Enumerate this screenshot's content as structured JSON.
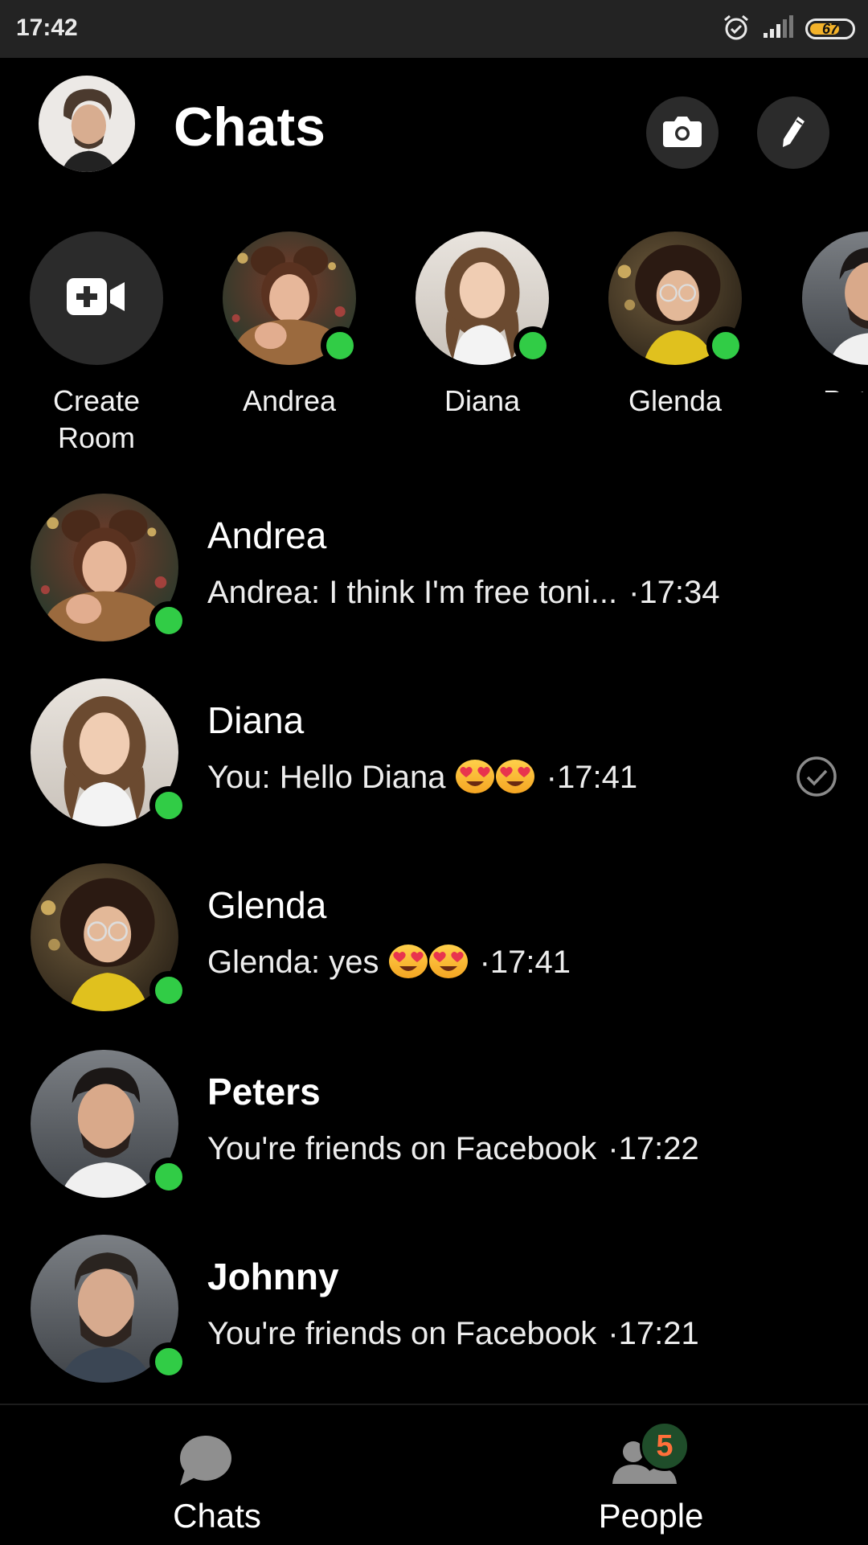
{
  "status_bar": {
    "time": "17:42",
    "battery": "67"
  },
  "header": {
    "title": "Chats"
  },
  "stories": [
    {
      "label": "Create Room"
    },
    {
      "label": "Andrea"
    },
    {
      "label": "Diana"
    },
    {
      "label": "Glenda"
    },
    {
      "label": "Pet"
    }
  ],
  "chats": [
    {
      "name": "Andrea",
      "preview": "Andrea: I think I'm free toni...",
      "time": "·17:34"
    },
    {
      "name": "Diana",
      "preview": "You: Hello Diana",
      "time": "·17:41"
    },
    {
      "name": "Glenda",
      "preview": "Glenda: yes",
      "time": "·17:41"
    },
    {
      "name": "Peters",
      "preview": "You're friends on Facebook",
      "time": "·17:22"
    },
    {
      "name": "Johnny",
      "preview": "You're friends on Facebook",
      "time": "·17:21"
    }
  ],
  "nav": {
    "chats_label": "Chats",
    "people_label": "People",
    "people_badge": "5"
  },
  "colors": {
    "background": "#000000",
    "online": "#31cc46",
    "button_bg": "#2b2b2b",
    "badge_text": "#ff6f3a",
    "battery": "#f3b22a"
  }
}
